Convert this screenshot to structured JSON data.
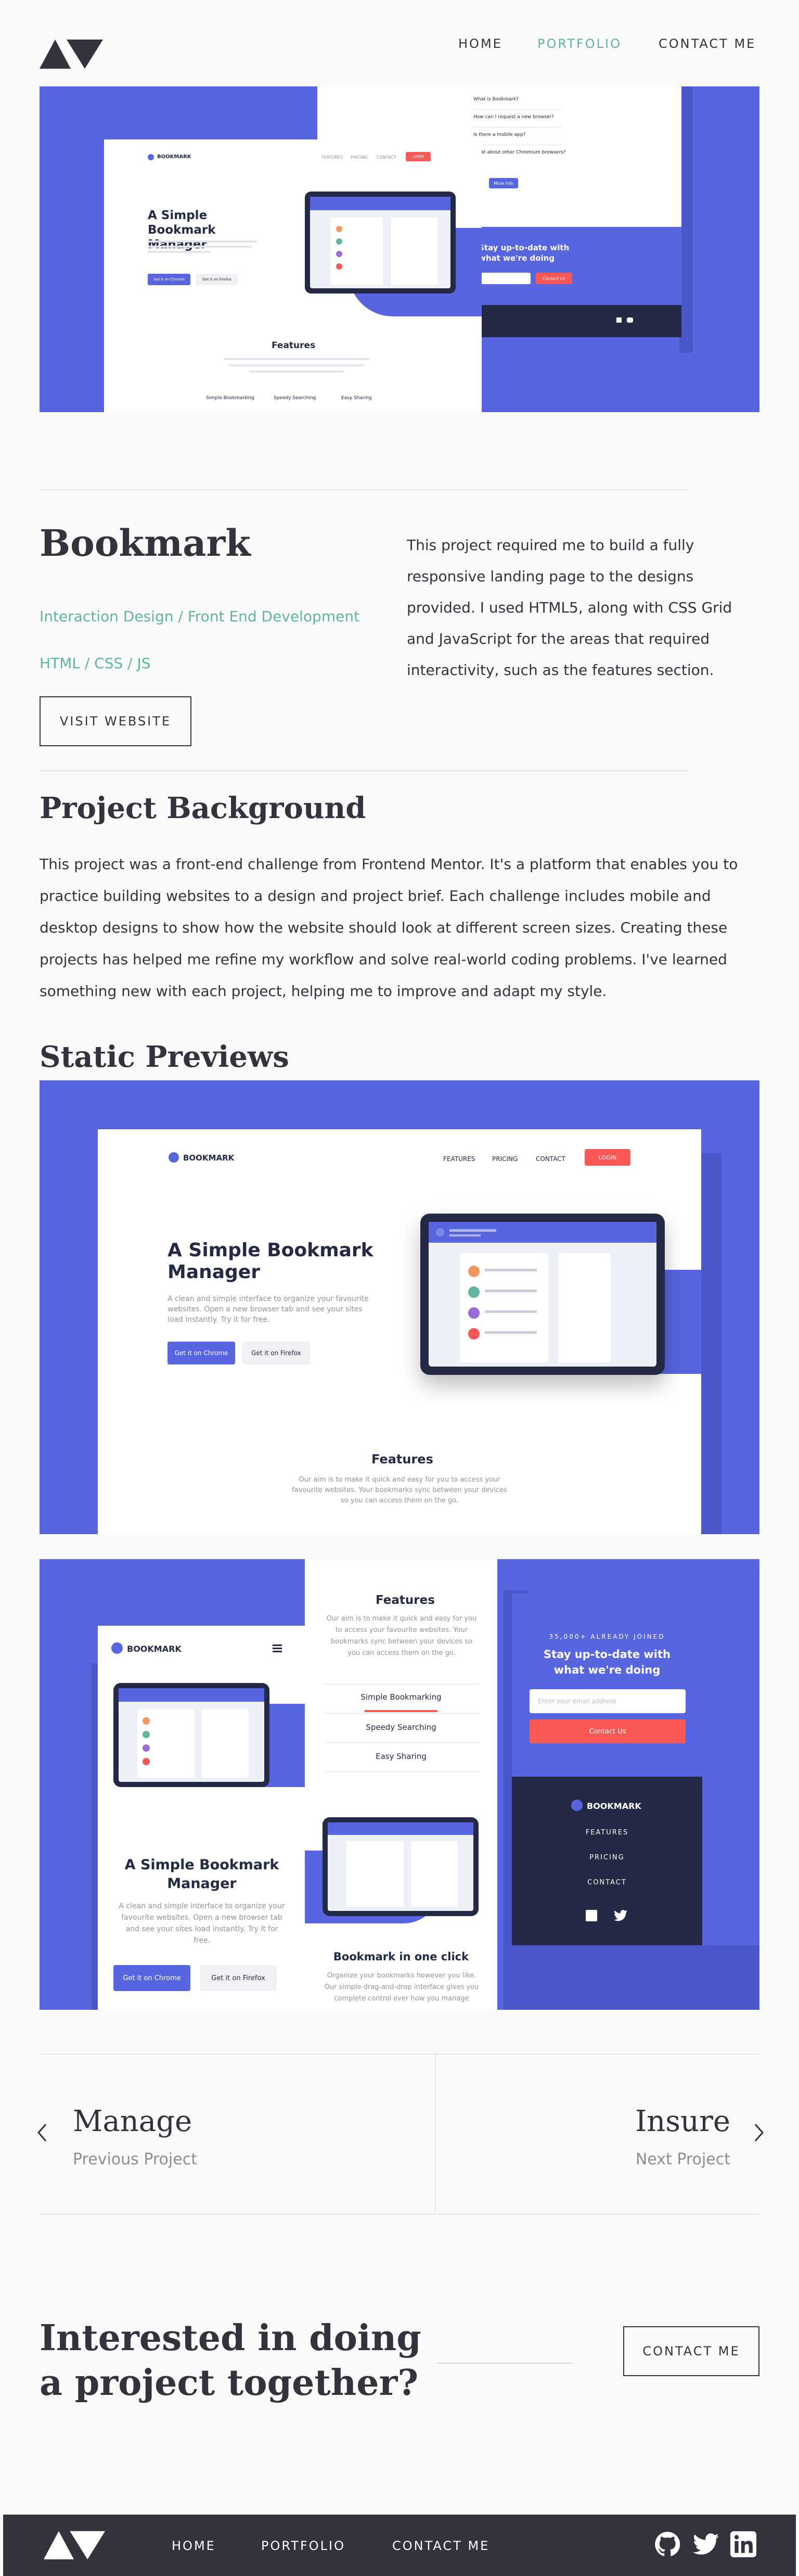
{
  "nav": {
    "home": "HOME",
    "portfolio": "PORTFOLIO",
    "contact": "CONTACT ME"
  },
  "hero_mock": {
    "brand": "BOOKMARK",
    "nav_features": "FEATURES",
    "nav_pricing": "PRICING",
    "nav_contact": "CONTACT",
    "login": "LOGIN",
    "headline": "A Simple Bookmark Manager",
    "chrome_btn": "Get it on Chrome",
    "firefox_btn": "Get it on Firefox",
    "features": "Features",
    "tab1": "Simple Bookmarking",
    "tab2": "Speedy Searching",
    "tab3": "Easy Sharing",
    "faq1": "What is Bookmark?",
    "faq2": "How can I request a new browser?",
    "faq3": "Is there a mobile app?",
    "faq4": "What about other Chromium browsers?",
    "more_info": "More Info",
    "stay_up": "Stay up-to-date with what we're doing",
    "contact_us": "Contact Us"
  },
  "project": {
    "title": "Bookmark",
    "category": "Interaction Design / Front End Development",
    "tech": "HTML / CSS / JS",
    "visit": "VISIT WEBSITE",
    "description": "This project required me to build a fully responsive landing page to the designs provided. I used HTML5, along with CSS Grid and JavaScript for the areas that required interactivity, such as the features section."
  },
  "background": {
    "heading": "Project Background",
    "text": "This project was a front-end challenge from Frontend Mentor. It's a platform that enables you to practice building websites to a design and project brief. Each challenge includes mobile and desktop designs to show how the website should look at different screen sizes. Creating these projects has helped me refine my workflow and solve real-world coding problems. I've learned something new with each project, helping me to improve and adapt my style."
  },
  "previews": {
    "heading": "Static Previews",
    "desktop": {
      "brand": "BOOKMARK",
      "nav_features": "FEATURES",
      "nav_pricing": "PRICING",
      "nav_contact": "CONTACT",
      "login": "LOGIN",
      "headline": "A Simple Bookmark Manager",
      "intro": "A clean and simple interface to organize your favourite websites. Open a new browser tab and see your sites load instantly. Try it for free.",
      "chrome_btn": "Get it on Chrome",
      "firefox_btn": "Get it on Firefox",
      "features": "Features",
      "features_text": "Our aim is to make it quick and easy for you to access your favourite websites. Your bookmarks sync between your devices so you can access them on the go."
    },
    "mobile": {
      "brand": "BOOKMARK",
      "headline": "A Simple Bookmark Manager",
      "intro": "A clean and simple interface to organize your favourite websites. Open a new browser tab and see your sites load instantly. Try it for free.",
      "chrome_btn": "Get it on Chrome",
      "firefox_btn": "Get it on Firefox",
      "features": "Features",
      "features_text": "Our aim is to make it quick and easy for you to access your favourite websites. Your bookmarks sync between your devices so you can access them on the go.",
      "tab1": "Simple Bookmarking",
      "tab2": "Speedy Searching",
      "tab3": "Easy Sharing",
      "bookmark_click": "Bookmark in one click",
      "bookmark_text": "Organize your bookmarks however you like. Our simple drag-and-drop interface gives you complete control over how you manage",
      "joined": "35,000+ ALREADY JOINED",
      "stay_up": "Stay up-to-date with what we're doing",
      "email_placeholder": "Enter your email address",
      "contact_us": "Contact Us",
      "footer_brand": "BOOKMARK",
      "footer_features": "FEATURES",
      "footer_pricing": "PRICING",
      "footer_contact": "CONTACT"
    }
  },
  "pager": {
    "prev_name": "Manage",
    "prev_label": "Previous Project",
    "next_name": "Insure",
    "next_label": "Next Project"
  },
  "cta": {
    "heading": "Interested in doing a project together?",
    "button": "CONTACT ME"
  },
  "footer": {
    "home": "HOME",
    "portfolio": "PORTFOLIO",
    "contact": "CONTACT ME"
  },
  "colors": {
    "accent": "#5fb4a2",
    "dark": "#33323d",
    "bookmark_blue": "#5765df",
    "bookmark_red": "#fa5757",
    "bookmark_navy": "#242a45"
  },
  "icons": {
    "logo": "logo-icon",
    "github": "github-icon",
    "twitter": "twitter-icon",
    "linkedin": "linkedin-icon",
    "prev": "chevron-left-icon",
    "next": "chevron-right-icon"
  }
}
